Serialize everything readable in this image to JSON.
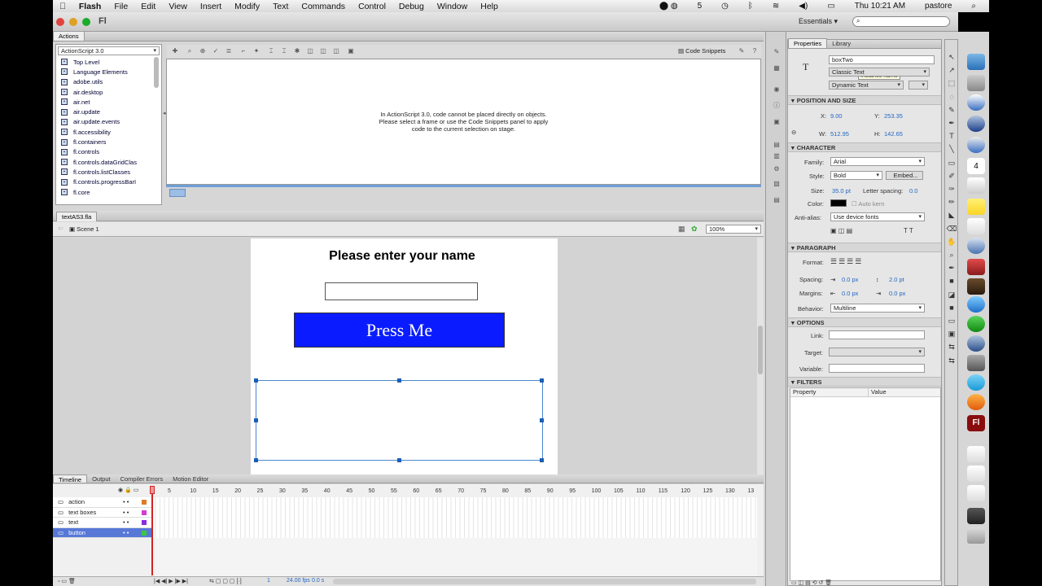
{
  "menubar": {
    "apple": "",
    "items": [
      "Flash",
      "File",
      "Edit",
      "View",
      "Insert",
      "Modify",
      "Text",
      "Commands",
      "Control",
      "Debug",
      "Window",
      "Help"
    ],
    "status_badge": "5",
    "clock": "Thu 10:21 AM",
    "user": "pastore"
  },
  "titlebar": {
    "app_icon": "Fl",
    "workspace": "Essentials",
    "search_placeholder": ""
  },
  "actions_panel": {
    "tab": "Actions",
    "language": "ActionScript 3.0",
    "tree": [
      "Top Level",
      "Language Elements",
      "adobe.utils",
      "air.desktop",
      "air.net",
      "air.update",
      "air.update.events",
      "fl.accessibility",
      "fl.containers",
      "fl.controls",
      "fl.controls.dataGridClas",
      "fl.controls.listClasses",
      "fl.controls.progressBarI",
      "fl.core"
    ],
    "code_snippets": "Code Snippets",
    "hint_line1": "In ActionScript 3.0, code cannot be placed directly on objects.",
    "hint_line2": "Please select a frame or use the Code Snippets panel to apply",
    "hint_line3": "code to the current selection on stage."
  },
  "document": {
    "tab": "textAS3.fla",
    "scene": "Scene 1",
    "zoom": "100%",
    "stage_heading": "Please enter your name",
    "button_label": "Press Me",
    "button_color": "#0a1cff"
  },
  "timeline": {
    "tabs": [
      "Timeline",
      "Output",
      "Compiler Errors",
      "Motion Editor"
    ],
    "ruler": [
      "5",
      "10",
      "15",
      "20",
      "25",
      "30",
      "35",
      "40",
      "45",
      "50",
      "55",
      "60",
      "65",
      "70",
      "75",
      "80",
      "85",
      "90",
      "95",
      "100",
      "105",
      "110",
      "115",
      "120",
      "125",
      "130",
      "13"
    ],
    "layers": [
      {
        "name": "action",
        "color": "#e07b2a"
      },
      {
        "name": "text boxes",
        "color": "#d23cd2"
      },
      {
        "name": "text",
        "color": "#8a2be2"
      },
      {
        "name": "button",
        "color": "#3cc83c"
      }
    ],
    "fps": "24.00 fps",
    "time": "0.0 s",
    "frame": "1"
  },
  "properties": {
    "tabs": [
      "Properties",
      "Library"
    ],
    "instance_name": "boxTwo",
    "tooltip": "Instance name",
    "text_engine": "Classic Text",
    "text_type": "Dynamic Text",
    "position_header": "POSITION AND SIZE",
    "x_label": "X:",
    "x": "9.00",
    "y_label": "Y:",
    "y": "253.35",
    "w_label": "W:",
    "w": "512.95",
    "h_label": "H:",
    "h": "142.65",
    "character_header": "CHARACTER",
    "family_label": "Family:",
    "family": "Arial",
    "style_label": "Style:",
    "style": "Bold",
    "embed": "Embed...",
    "size_label": "Size:",
    "size": "35.0 pt",
    "letter_spacing_label": "Letter spacing:",
    "letter_spacing": "0.0",
    "color_label": "Color:",
    "auto_kern": "Auto kern",
    "antialias_label": "Anti-alias:",
    "antialias": "Use device fonts",
    "paragraph_header": "PARAGRAPH",
    "format_label": "Format:",
    "spacing_label": "Spacing:",
    "indent": "0.0 px",
    "line_spacing": "2.0 pt",
    "margins_label": "Margins:",
    "margin_left": "0.0 px",
    "margin_right": "0.0 px",
    "behavior_label": "Behavior:",
    "behavior": "Multiline",
    "options_header": "OPTIONS",
    "link_label": "Link:",
    "target_label": "Target:",
    "variable_label": "Variable:",
    "filters_header": "FILTERS",
    "filters_col1": "Property",
    "filters_col2": "Value"
  },
  "dock": {
    "calendar_day": "4"
  }
}
